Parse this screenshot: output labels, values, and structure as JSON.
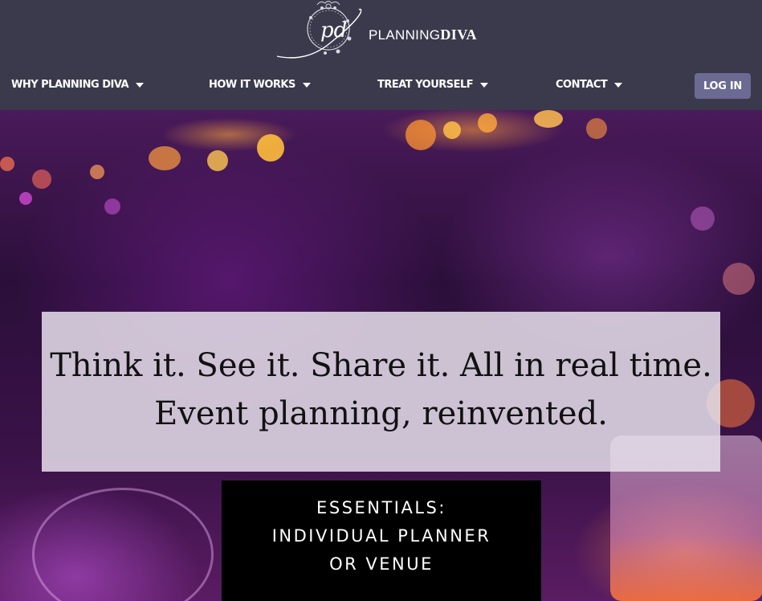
{
  "header": {
    "logo": {
      "monogram": "pd",
      "name_light": "PLANNING",
      "name_bold": "DIVA"
    },
    "nav": [
      {
        "label": "WHY PLANNING DIVA"
      },
      {
        "label": "HOW IT WORKS"
      },
      {
        "label": "TREAT YOURSELF"
      },
      {
        "label": "CONTACT"
      }
    ],
    "login_label": "LOG IN"
  },
  "hero": {
    "tagline_line1": "Think it. See it. Share it. All in real time.",
    "tagline_line2": "Event planning, reinvented.",
    "essentials": {
      "line1": "ESSENTIALS:",
      "line2": "INDIVIDUAL PLANNER",
      "line3": "OR VENUE"
    }
  },
  "colors": {
    "header_bg": "#3b3a4c",
    "login_bg": "#6b6a92",
    "tagline_box_bg": "#e8e2ec",
    "essentials_bg": "#000000"
  }
}
